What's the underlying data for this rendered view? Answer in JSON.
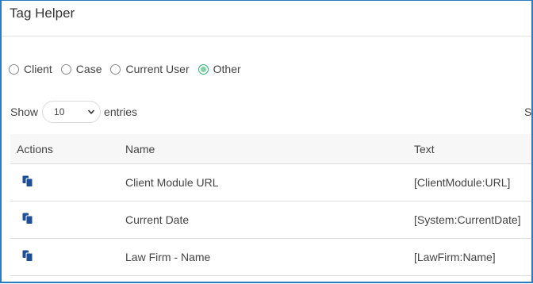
{
  "modal": {
    "title": "Tag Helper"
  },
  "filters": {
    "options": [
      {
        "label": "Client",
        "checked": false
      },
      {
        "label": "Case",
        "checked": false
      },
      {
        "label": "Current User",
        "checked": false
      },
      {
        "label": "Other",
        "checked": true
      }
    ]
  },
  "length": {
    "show_label": "Show",
    "entries_label": "entries",
    "selected": "10"
  },
  "search": {
    "label_fragment": "S"
  },
  "table": {
    "headers": [
      "Actions",
      "Name",
      "Text"
    ],
    "rows": [
      {
        "action_icon": "copy-icon",
        "name": "Client Module URL",
        "text": "[ClientModule:URL]"
      },
      {
        "action_icon": "copy-icon",
        "name": "Current Date",
        "text": "[System:CurrentDate]"
      },
      {
        "action_icon": "copy-icon",
        "name": "Law Firm - Name",
        "text": "[LawFirm:Name]"
      }
    ]
  },
  "colors": {
    "frame_border": "#2d7bbf",
    "icon": "#1f4e99",
    "radio_checked": "#2bb673"
  }
}
